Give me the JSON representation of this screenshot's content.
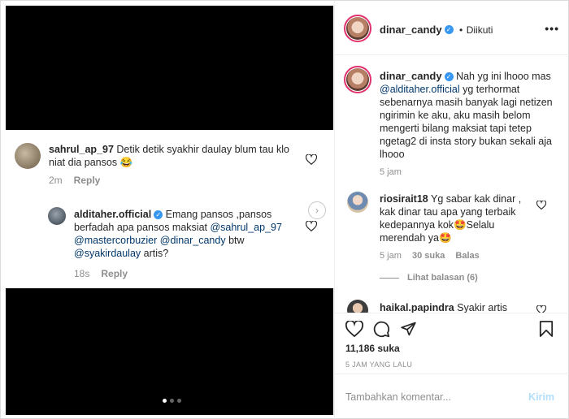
{
  "media": {
    "comment1": {
      "user": "sahrul_ap_97",
      "text": " Detik detik  syakhir daulay blum tau klo niat dia pansos 😂",
      "time": "2m",
      "reply": "Reply"
    },
    "comment2": {
      "user": "alditaher.official",
      "text1": " Emang pansos ,pansos berfadah apa pansos maksiat ",
      "mention1": "@sahrul_ap_97",
      "mention2": "@mastercorbuzier",
      "mention3": "@dinar_candy",
      "text2": "  btw ",
      "mention4": "@syakirdaulay",
      "text3": " artis?",
      "time": "18s",
      "reply": "Reply"
    }
  },
  "panel": {
    "header": {
      "username": "dinar_candy",
      "dot": "•",
      "follow": "Diikuti",
      "more": "•••"
    },
    "caption": {
      "username": "dinar_candy",
      "text1": " Nah yg ini lhooo mas ",
      "mention": "@alditaher.official",
      "text2": " yg terhormat sebenarnya masih banyak lagi netizen ngirimin ke aku, aku masih belom mengerti bilang maksiat tapi tetep ngetag2 di insta story bukan sekali aja lhooo",
      "time": "5 jam"
    },
    "comment1": {
      "username": "riosirait18",
      "text": " Yg sabar kak dinar , kak dinar tau apa yang terbaik kedepannya kok🤩Selalu merendah ya🤩",
      "time": "5 jam",
      "likes": "30 suka",
      "reply": "Balas",
      "view_replies": "Lihat balasan (6)"
    },
    "comment2": {
      "username": "haikal.papindra",
      "text": " Syakir artis"
    },
    "likes": "11,186 suka",
    "ago": "5 JAM YANG LALU",
    "input_placeholder": "Tambahkan komentar...",
    "post_label": "Kirim"
  }
}
